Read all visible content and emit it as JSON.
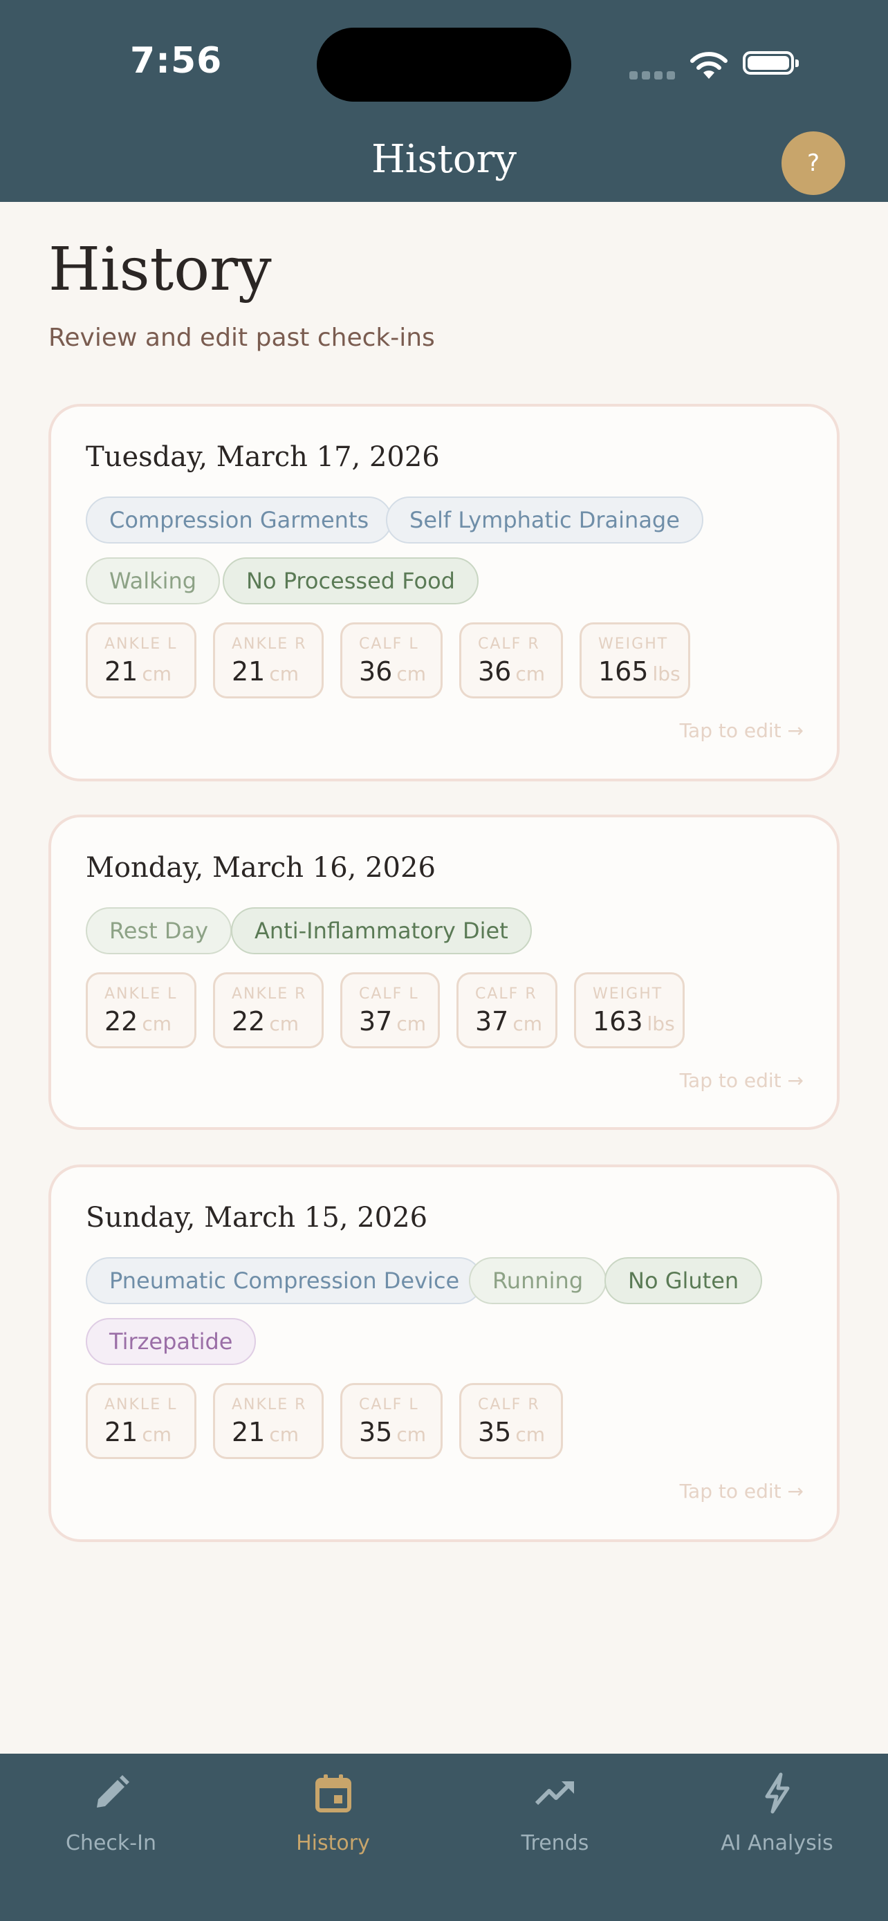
{
  "status_bar": {
    "time": "7:56"
  },
  "nav": {
    "title": "History",
    "help_label": "?"
  },
  "page": {
    "title": "History",
    "subtitle": "Review and edit past check-ins"
  },
  "cards": [
    {
      "date": "Tuesday, March 17, 2026",
      "tags": [
        {
          "label": "Compression Garments",
          "kind": "treatment"
        },
        {
          "label": "Self Lymphatic Drainage",
          "kind": "treatment"
        },
        {
          "label": "Walking",
          "kind": "activity"
        },
        {
          "label": "No Processed Food",
          "kind": "diet"
        }
      ],
      "metrics": [
        {
          "label": "ANKLE L",
          "value": "21",
          "unit": "cm"
        },
        {
          "label": "ANKLE R",
          "value": "21",
          "unit": "cm"
        },
        {
          "label": "CALF L",
          "value": "36",
          "unit": "cm"
        },
        {
          "label": "CALF R",
          "value": "36",
          "unit": "cm"
        },
        {
          "label": "WEIGHT",
          "value": "165",
          "unit": "lbs"
        }
      ],
      "edit_label": "Tap to edit →"
    },
    {
      "date": "Monday, March 16, 2026",
      "tags": [
        {
          "label": "Rest Day",
          "kind": "activity"
        },
        {
          "label": "Anti-Inflammatory Diet",
          "kind": "diet"
        }
      ],
      "metrics": [
        {
          "label": "ANKLE L",
          "value": "22",
          "unit": "cm"
        },
        {
          "label": "ANKLE R",
          "value": "22",
          "unit": "cm"
        },
        {
          "label": "CALF L",
          "value": "37",
          "unit": "cm"
        },
        {
          "label": "CALF R",
          "value": "37",
          "unit": "cm"
        },
        {
          "label": "WEIGHT",
          "value": "163",
          "unit": "lbs"
        }
      ],
      "edit_label": "Tap to edit →"
    },
    {
      "date": "Sunday, March 15, 2026",
      "tags": [
        {
          "label": "Pneumatic Compression Device",
          "kind": "treatment"
        },
        {
          "label": "Running",
          "kind": "activity"
        },
        {
          "label": "No Gluten",
          "kind": "diet"
        },
        {
          "label": "Tirzepatide",
          "kind": "medication"
        }
      ],
      "metrics": [
        {
          "label": "ANKLE L",
          "value": "21",
          "unit": "cm"
        },
        {
          "label": "ANKLE R",
          "value": "21",
          "unit": "cm"
        },
        {
          "label": "CALF L",
          "value": "35",
          "unit": "cm"
        },
        {
          "label": "CALF R",
          "value": "35",
          "unit": "cm"
        }
      ],
      "edit_label": "Tap to edit →"
    }
  ],
  "tabbar": {
    "tabs": [
      {
        "label": "Check-In",
        "icon": "pencil-icon"
      },
      {
        "label": "History",
        "icon": "calendar-icon",
        "active": true
      },
      {
        "label": "Trends",
        "icon": "trending-up-icon"
      },
      {
        "label": "AI Analysis",
        "icon": "lightning-icon"
      }
    ]
  },
  "colors": {
    "header": "#3d5763",
    "accent": "#c8a56b",
    "background": "#f9f6f2",
    "card_border": "#f2dfd8",
    "tag_treatment": "#6f8ea8",
    "tag_activity": "#8da286",
    "tag_diet": "#5a7a55",
    "tag_medication": "#9a6ea6"
  }
}
